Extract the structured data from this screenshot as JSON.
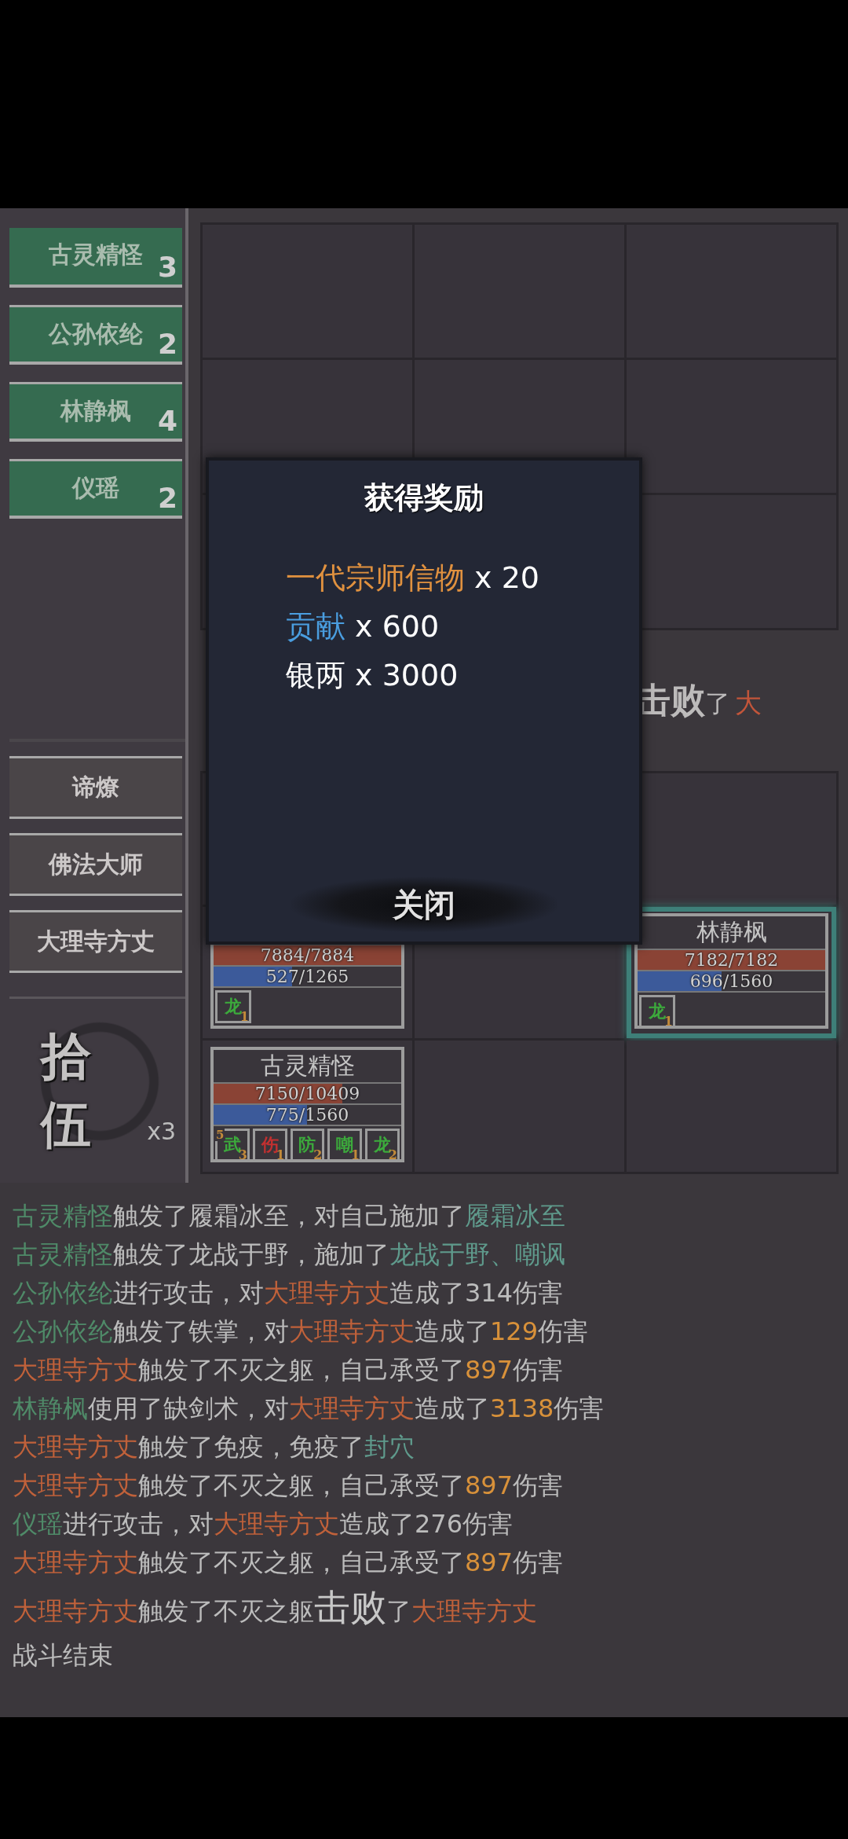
{
  "team": [
    {
      "name": "古灵精怪",
      "count": "3"
    },
    {
      "name": "公孙依纶",
      "count": "2"
    },
    {
      "name": "林静枫",
      "count": "4"
    },
    {
      "name": "仪瑶",
      "count": "2"
    }
  ],
  "enemies": [
    {
      "name": "谛燎"
    },
    {
      "name": "佛法大师"
    },
    {
      "name": "大理寺方丈"
    }
  ],
  "round": {
    "label": "拾伍",
    "multiplier": "x3"
  },
  "defeat_banner": [
    {
      "text": "击败",
      "kind": "big"
    },
    {
      "text": "了",
      "kind": "text"
    },
    {
      "text": "大",
      "kind": "enemy"
    }
  ],
  "player_rows": [
    [
      {
        "kind": "empty"
      },
      {
        "kind": "empty"
      },
      {
        "kind": "empty"
      }
    ],
    [
      {
        "kind": "unit",
        "selected": false,
        "hp": {
          "text": "7884/7884",
          "level": 1
        },
        "mp": {
          "text": "527/1265",
          "level": 0.417
        },
        "buffs": [
          {
            "label": "龙",
            "count": "1",
            "kind": "good"
          }
        ]
      },
      {
        "kind": "empty"
      },
      {
        "kind": "unit",
        "name": "林静枫",
        "selected": true,
        "hp": {
          "text": "7182/7182",
          "level": 1
        },
        "mp": {
          "text": "696/1560",
          "level": 0.446
        },
        "buffs": [
          {
            "label": "龙",
            "count": "1",
            "kind": "good"
          }
        ]
      }
    ],
    [
      {
        "kind": "unit",
        "name": "古灵精怪",
        "selected": false,
        "hp": {
          "text": "7150/10409",
          "level": 0.687
        },
        "mp": {
          "text": "775/1560",
          "level": 0.497
        },
        "buffs": [
          {
            "label": "武",
            "count": "3",
            "corner": "5",
            "kind": "good"
          },
          {
            "label": "伤",
            "count": "1",
            "kind": "bad"
          },
          {
            "label": "防",
            "count": "2",
            "kind": "good"
          },
          {
            "label": "嘲",
            "count": "1",
            "kind": "good"
          },
          {
            "label": "龙",
            "count": "2",
            "kind": "good"
          }
        ]
      },
      {
        "kind": "empty"
      },
      {
        "kind": "empty"
      }
    ]
  ],
  "dialog": {
    "title": "获得奖励",
    "rewards": [
      {
        "name": "一代宗师信物",
        "amount": "x 20",
        "color": "#e0913f"
      },
      {
        "name": "贡献",
        "amount": "x 600",
        "color": "#4a9ee0"
      },
      {
        "name": "银两",
        "amount": "x 3000",
        "color": "#ffffff"
      }
    ],
    "close_label": "关闭"
  },
  "log": [
    [
      {
        "text": "古灵精怪",
        "kind": "ally"
      },
      {
        "text": "触发了履霜冰至，对自己施加了",
        "kind": "text"
      },
      {
        "text": "履霜冰至",
        "kind": "skill"
      }
    ],
    [
      {
        "text": "古灵精怪",
        "kind": "ally"
      },
      {
        "text": "触发了龙战于野，施加了",
        "kind": "text"
      },
      {
        "text": "龙战于野、嘲讽",
        "kind": "skill"
      }
    ],
    [
      {
        "text": "公孙依纶",
        "kind": "ally"
      },
      {
        "text": "进行攻击，对",
        "kind": "text"
      },
      {
        "text": "大理寺方丈",
        "kind": "enemy"
      },
      {
        "text": "造成了314伤害",
        "kind": "text"
      }
    ],
    [
      {
        "text": "公孙依纶",
        "kind": "ally"
      },
      {
        "text": "触发了铁掌，对",
        "kind": "text"
      },
      {
        "text": "大理寺方丈",
        "kind": "enemy"
      },
      {
        "text": "造成了",
        "kind": "text"
      },
      {
        "text": "129",
        "kind": "number"
      },
      {
        "text": "伤害",
        "kind": "text"
      }
    ],
    [
      {
        "text": "大理寺方丈",
        "kind": "enemy"
      },
      {
        "text": "触发了不灭之躯，自己承受了",
        "kind": "text"
      },
      {
        "text": "897",
        "kind": "number"
      },
      {
        "text": "伤害",
        "kind": "text"
      }
    ],
    [
      {
        "text": "林静枫",
        "kind": "ally"
      },
      {
        "text": "使用了缺剑术，对",
        "kind": "text"
      },
      {
        "text": "大理寺方丈",
        "kind": "enemy"
      },
      {
        "text": "造成了",
        "kind": "text"
      },
      {
        "text": "3138",
        "kind": "number"
      },
      {
        "text": "伤害",
        "kind": "text"
      }
    ],
    [
      {
        "text": "大理寺方丈",
        "kind": "enemy"
      },
      {
        "text": "触发了免疫，免疫了",
        "kind": "text"
      },
      {
        "text": "封穴",
        "kind": "skill"
      }
    ],
    [
      {
        "text": "大理寺方丈",
        "kind": "enemy"
      },
      {
        "text": "触发了不灭之躯，自己承受了",
        "kind": "text"
      },
      {
        "text": "897",
        "kind": "number"
      },
      {
        "text": "伤害",
        "kind": "text"
      }
    ],
    [
      {
        "text": "仪瑶",
        "kind": "ally"
      },
      {
        "text": "进行攻击，对",
        "kind": "text"
      },
      {
        "text": "大理寺方丈",
        "kind": "enemy"
      },
      {
        "text": "造成了276伤害",
        "kind": "text"
      }
    ],
    [
      {
        "text": "大理寺方丈",
        "kind": "enemy"
      },
      {
        "text": "触发了不灭之躯，自己承受了",
        "kind": "text"
      },
      {
        "text": "897",
        "kind": "number"
      },
      {
        "text": "伤害",
        "kind": "text"
      }
    ],
    [
      {
        "text": "大理寺方丈",
        "kind": "enemy"
      },
      {
        "text": "触发了不灭之躯",
        "kind": "text"
      },
      {
        "text": "击败",
        "kind": "big"
      },
      {
        "text": "了",
        "kind": "text"
      },
      {
        "text": "大理寺方丈",
        "kind": "enemy"
      }
    ],
    [
      {
        "text": "战斗结束",
        "kind": "text"
      }
    ]
  ]
}
